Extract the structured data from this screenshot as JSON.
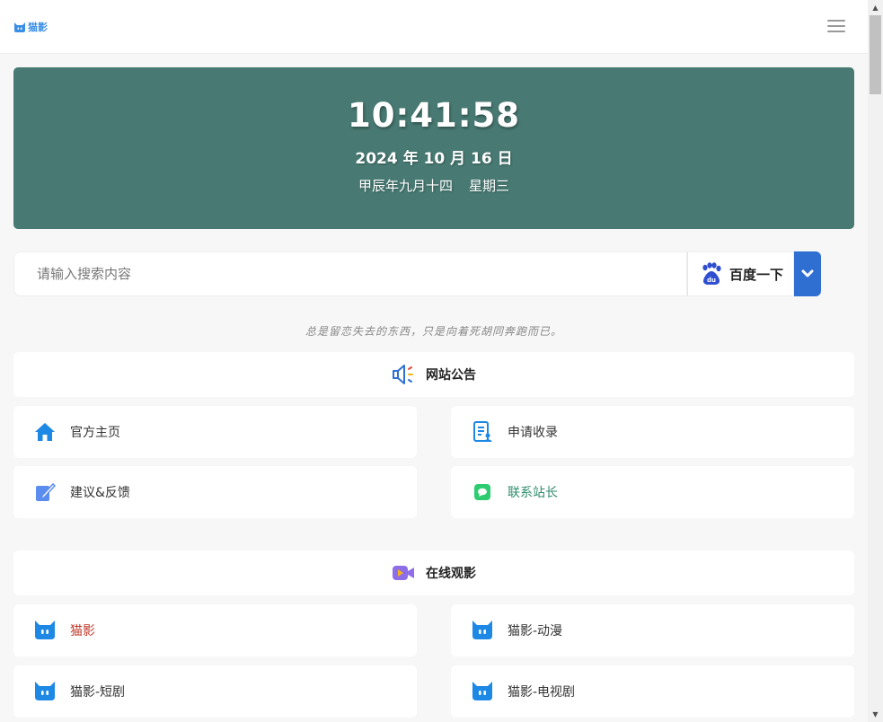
{
  "header": {
    "logo_text": "猫影",
    "logo_icon": "cat-face-icon",
    "menu_icon": "hamburger-menu-icon"
  },
  "clock": {
    "time": "10:41:58",
    "date": "2024 年 10 月 16 日",
    "lunar": "甲辰年九月十四",
    "weekday": "星期三",
    "bg_color": "#487a73"
  },
  "search": {
    "placeholder": "请输入搜索内容",
    "value": "",
    "engine_label": "百度一下",
    "engine_icon": "baidu-paw-icon",
    "dropdown_icon": "chevron-down-icon",
    "accent": "#2f6fd1"
  },
  "motto": "总是留恋失去的东西，只是向着死胡同奔跑而已。",
  "sections": [
    {
      "title": "网站公告",
      "icon": "speaker-icon",
      "items": [
        {
          "label": "官方主页",
          "icon": "home-icon",
          "color": "#333333"
        },
        {
          "label": "申请收录",
          "icon": "document-user-icon",
          "color": "#333333"
        },
        {
          "label": "建议&反馈",
          "icon": "pencil-edit-icon",
          "color": "#333333"
        },
        {
          "label": "联系站长",
          "icon": "chat-bubble-icon",
          "color": "#2e8b6e"
        }
      ]
    },
    {
      "title": "在线观影",
      "icon": "video-camera-icon",
      "items": [
        {
          "label": "猫影",
          "icon": "cat-face-icon",
          "color": "#c0392b"
        },
        {
          "label": "猫影-动漫",
          "icon": "cat-face-icon",
          "color": "#333333"
        },
        {
          "label": "猫影-短剧",
          "icon": "cat-face-icon",
          "color": "#333333"
        },
        {
          "label": "猫影-电视剧",
          "icon": "cat-face-icon",
          "color": "#333333"
        }
      ]
    }
  ]
}
